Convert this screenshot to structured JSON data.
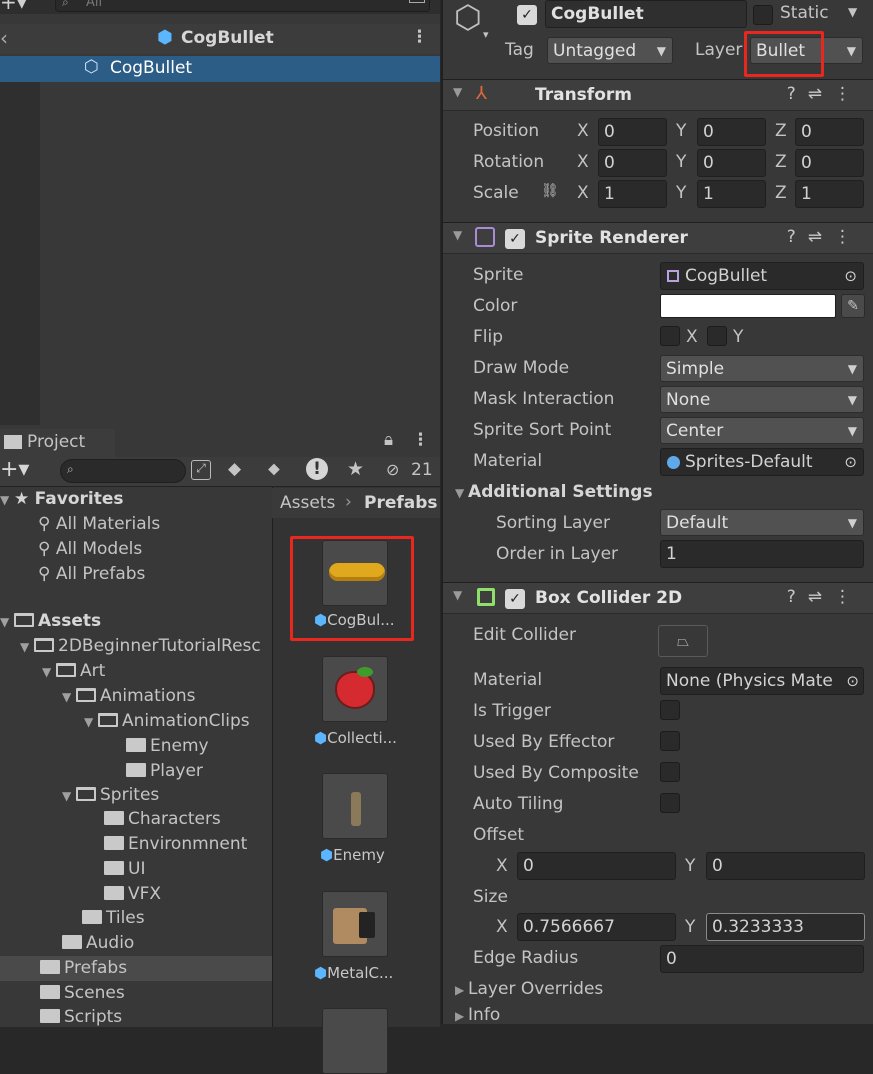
{
  "hierarchy": {
    "search_placeholder": "All",
    "title": "CogBullet",
    "selected_item": "CogBullet"
  },
  "project": {
    "tab_label": "Project",
    "hidden_count": "21",
    "breadcrumb": [
      "Assets",
      "Prefabs"
    ],
    "favorites_label": "Favorites",
    "favorites": [
      "All Materials",
      "All Models",
      "All Prefabs"
    ],
    "tree": [
      {
        "label": "Assets"
      },
      {
        "label": "2DBeginnerTutorialResc"
      },
      {
        "label": "Art"
      },
      {
        "label": "Animations"
      },
      {
        "label": "AnimationClips"
      },
      {
        "label": "Enemy"
      },
      {
        "label": "Player"
      },
      {
        "label": "Sprites"
      },
      {
        "label": "Characters"
      },
      {
        "label": "Environmnent"
      },
      {
        "label": "UI"
      },
      {
        "label": "VFX"
      },
      {
        "label": "Tiles"
      },
      {
        "label": "Audio"
      },
      {
        "label": "Prefabs"
      },
      {
        "label": "Scenes"
      },
      {
        "label": "Scripts"
      }
    ],
    "assets": [
      "CogBul...",
      "Collecti...",
      "Enemy",
      "MetalC..."
    ]
  },
  "inspector": {
    "object_name": "CogBullet",
    "static_label": "Static",
    "tag_label": "Tag",
    "tag_value": "Untagged",
    "layer_label": "Layer",
    "layer_value": "Bullet",
    "transform": {
      "title": "Transform",
      "position_label": "Position",
      "rotation_label": "Rotation",
      "scale_label": "Scale",
      "position": [
        "0",
        "0",
        "0"
      ],
      "rotation": [
        "0",
        "0",
        "0"
      ],
      "scale": [
        "1",
        "1",
        "1"
      ],
      "axes": [
        "X",
        "Y",
        "Z"
      ]
    },
    "sprite_renderer": {
      "title": "Sprite Renderer",
      "sprite_label": "Sprite",
      "sprite_value": "CogBullet",
      "color_label": "Color",
      "color_value": "#ffffff",
      "flip_label": "Flip",
      "flip_x": "X",
      "flip_y": "Y",
      "draw_mode_label": "Draw Mode",
      "draw_mode_value": "Simple",
      "mask_label": "Mask Interaction",
      "mask_value": "None",
      "sort_point_label": "Sprite Sort Point",
      "sort_point_value": "Center",
      "material_label": "Material",
      "material_value": "Sprites-Default",
      "additional_settings_label": "Additional Settings",
      "sorting_layer_label": "Sorting Layer",
      "sorting_layer_value": "Default",
      "order_label": "Order in Layer",
      "order_value": "1"
    },
    "box_collider": {
      "title": "Box Collider 2D",
      "edit_collider_label": "Edit Collider",
      "material_label": "Material",
      "material_value": "None (Physics Mate",
      "is_trigger_label": "Is Trigger",
      "used_by_effector_label": "Used By Effector",
      "used_by_composite_label": "Used By Composite",
      "auto_tiling_label": "Auto Tiling",
      "offset_label": "Offset",
      "offset_x": "0",
      "offset_y": "0",
      "size_label": "Size",
      "size_x": "0.7566667",
      "size_y": "0.3233333",
      "edge_radius_label": "Edge Radius",
      "edge_radius_value": "0",
      "layer_overrides_label": "Layer Overrides",
      "info_label": "Info"
    }
  },
  "colors": {
    "highlight": "#e8281e",
    "selection": "#2c5d87",
    "prefab_icon": "#5cb6ff"
  }
}
